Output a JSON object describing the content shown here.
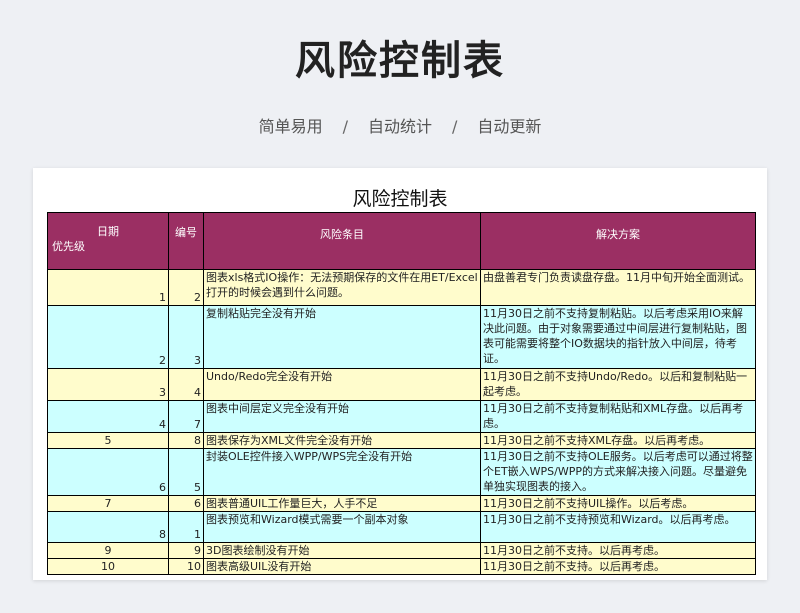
{
  "hero": {
    "title": "风险控制表",
    "subtitle_items": [
      "简单易用",
      "自动统计",
      "自动更新"
    ],
    "separator": "/"
  },
  "sheet": {
    "title": "风险控制表",
    "headers": {
      "date": "日期",
      "priority": "优先级",
      "seq": "编号",
      "risk": "风险条目",
      "solution": "解决方案"
    },
    "rows": [
      {
        "priority": "1",
        "seq": "2",
        "risk": "图表xls格式IO操作：无法预期保存的文件在用ET/Excel打开的时候会遇到什么问题。",
        "solution": "由盘善君专门负责读盘存盘。11月中旬开始全面测试。"
      },
      {
        "priority": "2",
        "seq": "3",
        "risk": "复制粘贴完全没有开始",
        "solution": "11月30日之前不支持复制粘贴。以后考虑采用IO来解决此问题。由于对象需要通过中间层进行复制粘贴，图表可能需要将整个IO数据块的指针放入中间层，待考证。"
      },
      {
        "priority": "3",
        "seq": "4",
        "risk": "Undo/Redo完全没有开始",
        "solution": "11月30日之前不支持Undo/Redo。以后和复制粘贴一起考虑。"
      },
      {
        "priority": "4",
        "seq": "7",
        "risk": "图表中间层定义完全没有开始",
        "solution": "11月30日之前不支持复制粘贴和XML存盘。以后再考虑。"
      },
      {
        "priority": "5",
        "seq": "8",
        "risk": "图表保存为XML文件完全没有开始",
        "solution": "11月30日之前不支持XML存盘。以后再考虑。"
      },
      {
        "priority": "6",
        "seq": "5",
        "risk": "封装OLE控件接入WPP/WPS完全没有开始",
        "solution": "11月30日之前不支持OLE服务。以后考虑可以通过将整个ET嵌入WPS/WPP的方式来解决接入问题。尽量避免单独实现图表的接入。"
      },
      {
        "priority": "7",
        "seq": "6",
        "risk": "图表普通UIL工作量巨大，人手不足",
        "solution": "11月30日之前不支持UIL操作。以后考虑。"
      },
      {
        "priority": "8",
        "seq": "1",
        "risk": "图表预览和Wizard模式需要一个副本对象",
        "solution": "11月30日之前不支持预览和Wizard。以后再考虑。"
      },
      {
        "priority": "9",
        "seq": "9",
        "risk": "3D图表绘制没有开始",
        "solution": "11月30日之前不支持。以后再考虑。"
      },
      {
        "priority": "10",
        "seq": "10",
        "risk": "图表高级UIL没有开始",
        "solution": "11月30日之前不支持。以后再考虑。"
      }
    ]
  },
  "colors": {
    "header_bg": "#9b2f63",
    "row_yellow": "#fffccc",
    "row_cyan": "#ccffff"
  }
}
